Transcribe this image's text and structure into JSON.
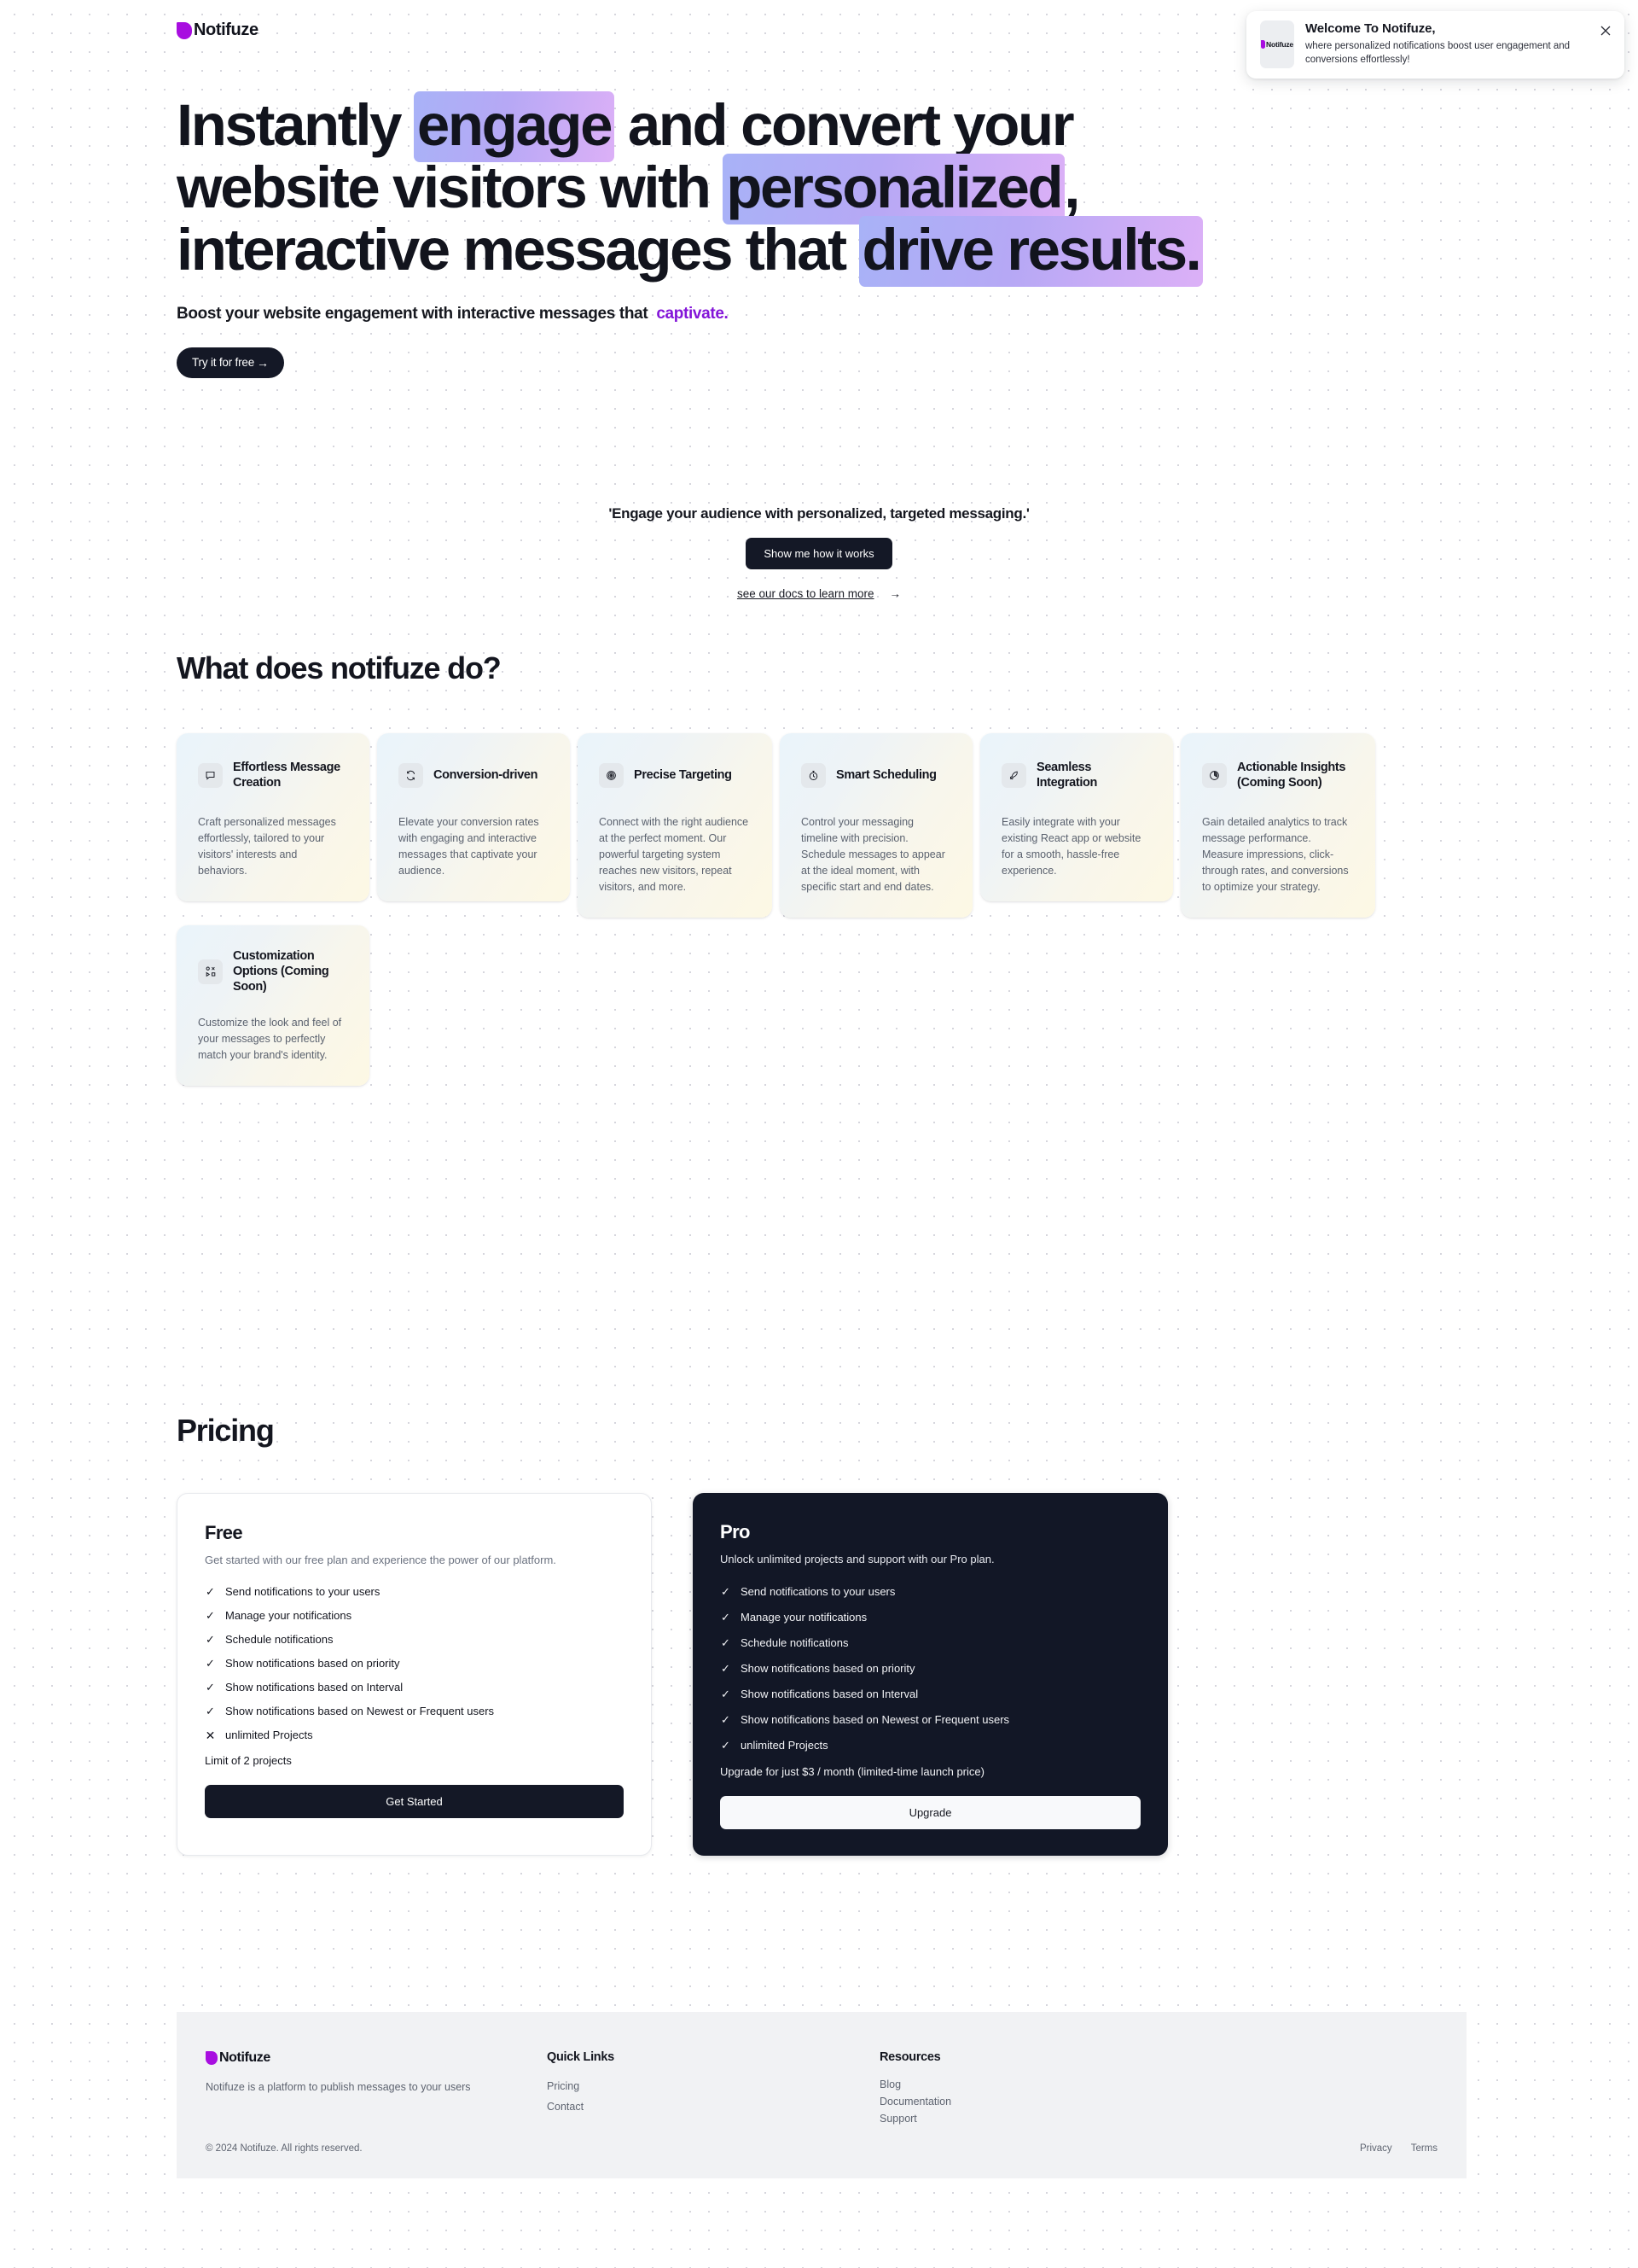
{
  "header": {
    "logo_text": "Notifuze",
    "logo_color": "#a80ee0"
  },
  "toast": {
    "title": "Welcome To Notifuze,",
    "description": "where personalized notifications boost user engagement and conversions effortlessly!",
    "thumb_label": "Notifuze",
    "close_label": "×"
  },
  "hero": {
    "headline_parts": [
      {
        "text": "Instantly ",
        "highlight": false
      },
      {
        "text": "engage",
        "highlight": true
      },
      {
        "text": " and convert your website visitors with ",
        "highlight": false
      },
      {
        "text": "personalized",
        "highlight": true
      },
      {
        "text": ", interactive messages that ",
        "highlight": false
      },
      {
        "text": "drive results.",
        "highlight": true
      }
    ],
    "headline_plain": "Instantly engage and convert your website visitors with personalized, interactive messages that drive results.",
    "subheading": "Boost your website engagement with interactive messages that",
    "subheading_accent": "captivate.",
    "cta_label": "Try it for free",
    "cta_arrow": "→",
    "highlight_gradient_from": "#a8b2f7",
    "highlight_gradient_to": "#dcb0f7",
    "accent_color": "#8315d8"
  },
  "midcta": {
    "quote": "'Engage your audience with personalized, targeted messaging.'",
    "button_label": "Show me how it works",
    "docs_link_label": "see our docs to learn more",
    "docs_link_arrow": "→"
  },
  "features": {
    "title": "What does notifuze do?",
    "cards": [
      {
        "icon": "message-bubble-icon",
        "title": "Effortless Message Creation",
        "description": "Craft personalized messages effortlessly, tailored to your visitors' interests and behaviors."
      },
      {
        "icon": "refresh-cycle-icon",
        "title": "Conversion-driven",
        "description": "Elevate your conversion rates with engaging and interactive messages that captivate your audience."
      },
      {
        "icon": "target-icon",
        "title": "Precise Targeting",
        "description": "Connect with the right audience at the perfect moment. Our powerful targeting system reaches new visitors, repeat visitors, and more."
      },
      {
        "icon": "stopwatch-icon",
        "title": "Smart Scheduling",
        "description": "Control your messaging timeline with precision. Schedule messages to appear at the ideal moment, with specific start and end dates."
      },
      {
        "icon": "rocket-icon",
        "title": "Seamless Integration",
        "description": "Easily integrate with your existing React app or website for a smooth, hassle-free experience."
      },
      {
        "icon": "pie-chart-icon",
        "title": "Actionable Insights (Coming Soon)",
        "description": "Gain detailed analytics to track message performance. Measure impressions, click-through rates, and conversions to optimize your strategy."
      },
      {
        "icon": "shapes-grid-icon",
        "title": "Customization Options (Coming Soon)",
        "description": "Customize the look and feel of your messages to perfectly match your brand's identity."
      }
    ]
  },
  "pricing": {
    "title": "Pricing",
    "plans": [
      {
        "name": "Free",
        "subtitle": "Get started with our free plan and experience the power of our platform.",
        "features": [
          {
            "label": "Send notifications to your users",
            "included": true
          },
          {
            "label": "Manage your notifications",
            "included": true
          },
          {
            "label": "Schedule notifications",
            "included": true
          },
          {
            "label": "Show notifications based on priority",
            "included": true
          },
          {
            "label": "Show notifications based on Interval",
            "included": true
          },
          {
            "label": "Show notifications based on Newest or Frequent users",
            "included": true
          },
          {
            "label": "unlimited Projects",
            "included": false
          }
        ],
        "note": "Limit of 2 projects",
        "button_label": "Get Started"
      },
      {
        "name": "Pro",
        "subtitle": "Unlock unlimited projects and support with our Pro plan.",
        "features": [
          {
            "label": "Send notifications to your users",
            "included": true
          },
          {
            "label": "Manage your notifications",
            "included": true
          },
          {
            "label": "Schedule notifications",
            "included": true
          },
          {
            "label": "Show notifications based on priority",
            "included": true
          },
          {
            "label": "Show notifications based on Interval",
            "included": true
          },
          {
            "label": "Show notifications based on Newest or Frequent users",
            "included": true
          },
          {
            "label": "unlimited Projects",
            "included": true
          }
        ],
        "note": "Upgrade for just $3 / month (limited-time launch price)",
        "button_label": "Upgrade"
      }
    ],
    "check_glyph": "✓",
    "cross_glyph": "✕"
  },
  "footer": {
    "logo_text": "Notifuze",
    "description": "Notifuze is a platform to publish messages to your users",
    "columns": [
      {
        "title": "Quick Links",
        "items": [
          "Pricing",
          "Contact"
        ]
      },
      {
        "title": "Resources",
        "items": [
          "Blog",
          "Documentation",
          "Support"
        ]
      }
    ],
    "copyright": "© 2024 Notifuze. All rights reserved.",
    "legal": [
      "Privacy",
      "Terms"
    ]
  }
}
